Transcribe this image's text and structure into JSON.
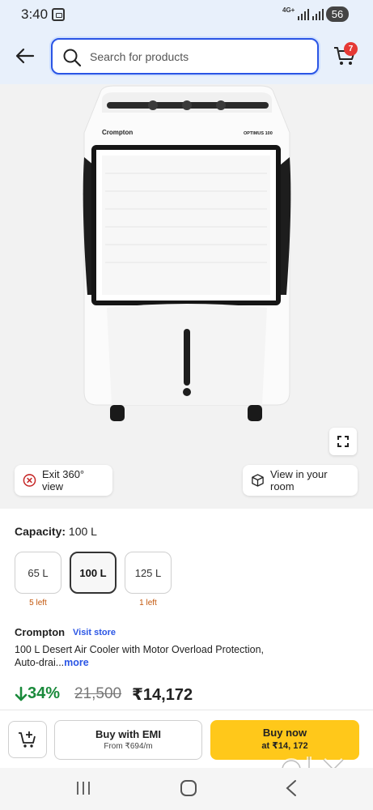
{
  "status_bar": {
    "time": "3:40",
    "network": "4G+",
    "battery": "56"
  },
  "header": {
    "search_placeholder": "Search for products",
    "cart_count": "7"
  },
  "gallery": {
    "product_brand_print": "Crompton",
    "product_model_print": "OPTIMUS 100",
    "exit_360_label": "Exit 360° view",
    "view_in_room_label": "View in your room"
  },
  "capacity": {
    "label": "Capacity:",
    "selected_value": "100 L",
    "options": [
      {
        "label": "65 L",
        "note": "5 left"
      },
      {
        "label": "100 L",
        "note": ""
      },
      {
        "label": "125 L",
        "note": "1 left"
      }
    ]
  },
  "product": {
    "brand": "Crompton",
    "visit_store": "Visit store",
    "title_line1": "100 L Desert Air Cooler with Motor Overload Protection,",
    "title_line2": "Auto-drai...",
    "more_link": "more"
  },
  "pricing": {
    "discount": "34%",
    "mrp": "21,500",
    "price": "₹14,172"
  },
  "actions": {
    "emi_label": "Buy with EMI",
    "emi_sub": "From ₹694/m",
    "buy_label": "Buy now",
    "buy_sub": "at ₹14, 172"
  },
  "watermark": {
    "text": "OLX"
  },
  "colors": {
    "accent_blue": "#2a55e5",
    "buy_yellow": "#ffc81a",
    "discount_green": "#1a8a3b",
    "badge_red": "#e53935",
    "stock_orange": "#c3570c"
  }
}
